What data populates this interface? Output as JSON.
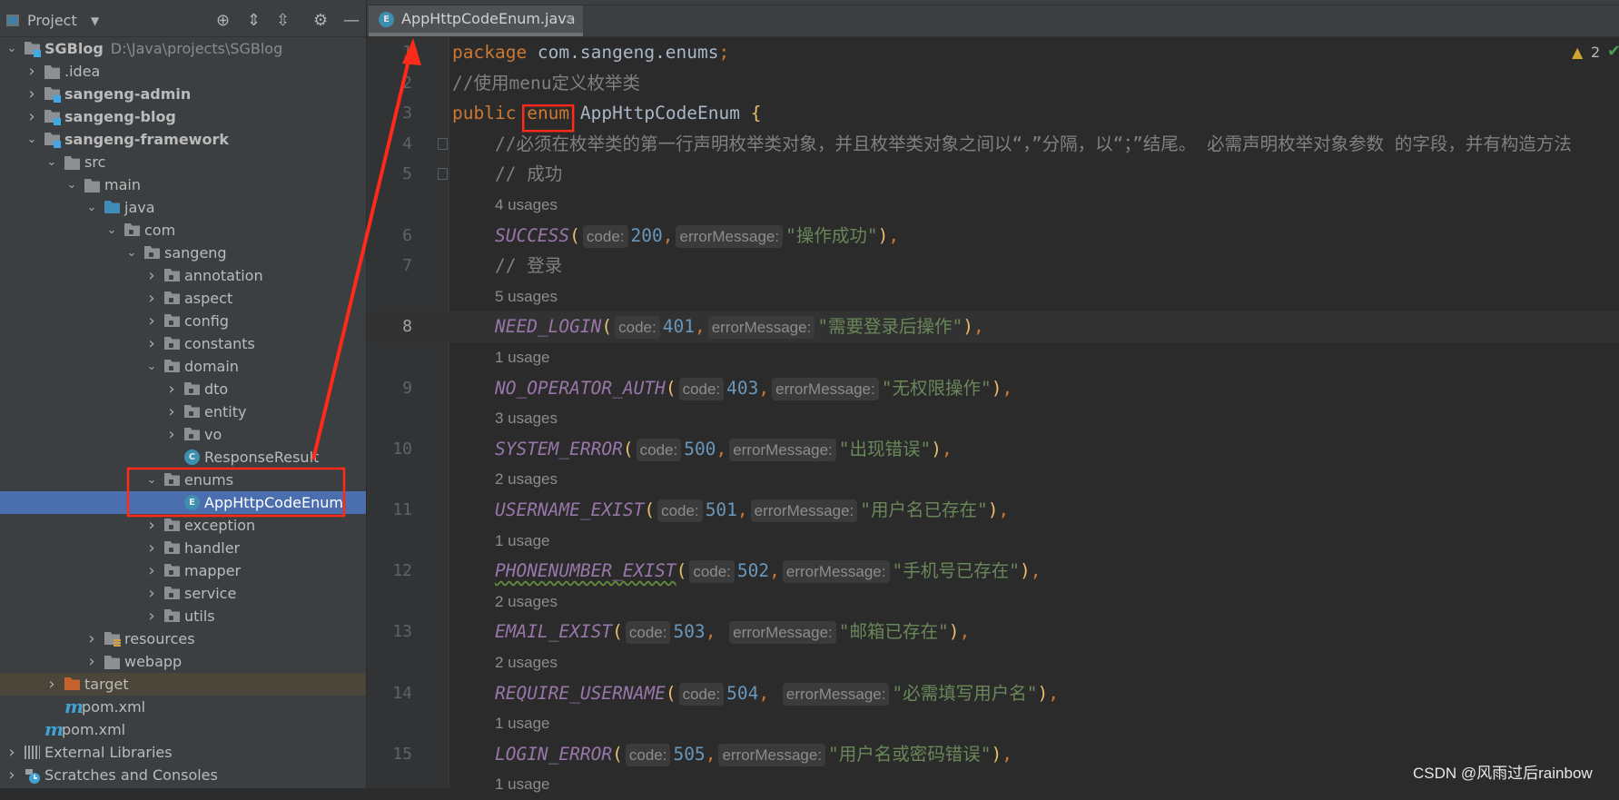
{
  "project_panel": {
    "title": "Project",
    "header_icons": [
      "locate-icon",
      "expand-all-icon",
      "collapse-all-icon",
      "gear-icon",
      "minimize-icon"
    ],
    "tree": [
      {
        "label": "SGBlog",
        "path": "D:\\Java\\projects\\SGBlog",
        "level": 0,
        "arrow": "open",
        "icon": "module",
        "bold": true
      },
      {
        "label": ".idea",
        "level": 1,
        "arrow": "closed",
        "icon": "folder"
      },
      {
        "label": "sangeng-admin",
        "level": 1,
        "arrow": "closed",
        "icon": "module",
        "bold": true
      },
      {
        "label": "sangeng-blog",
        "level": 1,
        "arrow": "closed",
        "icon": "module",
        "bold": true
      },
      {
        "label": "sangeng-framework",
        "level": 1,
        "arrow": "open",
        "icon": "module",
        "bold": true
      },
      {
        "label": "src",
        "level": 2,
        "arrow": "open",
        "icon": "folder"
      },
      {
        "label": "main",
        "level": 3,
        "arrow": "open",
        "icon": "folder"
      },
      {
        "label": "java",
        "level": 4,
        "arrow": "open",
        "icon": "java"
      },
      {
        "label": "com",
        "level": 5,
        "arrow": "open",
        "icon": "package"
      },
      {
        "label": "sangeng",
        "level": 6,
        "arrow": "open",
        "icon": "package"
      },
      {
        "label": "annotation",
        "level": 7,
        "arrow": "closed",
        "icon": "package"
      },
      {
        "label": "aspect",
        "level": 7,
        "arrow": "closed",
        "icon": "package"
      },
      {
        "label": "config",
        "level": 7,
        "arrow": "closed",
        "icon": "package"
      },
      {
        "label": "constants",
        "level": 7,
        "arrow": "closed",
        "icon": "package"
      },
      {
        "label": "domain",
        "level": 7,
        "arrow": "open",
        "icon": "package"
      },
      {
        "label": "dto",
        "level": 8,
        "arrow": "closed",
        "icon": "package"
      },
      {
        "label": "entity",
        "level": 8,
        "arrow": "closed",
        "icon": "package"
      },
      {
        "label": "vo",
        "level": 8,
        "arrow": "closed",
        "icon": "package"
      },
      {
        "label": "ResponseResult",
        "level": 8,
        "arrow": "none",
        "icon": "class"
      },
      {
        "label": "enums",
        "level": 7,
        "arrow": "open",
        "icon": "package"
      },
      {
        "label": "AppHttpCodeEnum",
        "level": 8,
        "arrow": "none",
        "icon": "enum",
        "selected": true
      },
      {
        "label": "exception",
        "level": 7,
        "arrow": "closed",
        "icon": "package"
      },
      {
        "label": "handler",
        "level": 7,
        "arrow": "closed",
        "icon": "package"
      },
      {
        "label": "mapper",
        "level": 7,
        "arrow": "closed",
        "icon": "package"
      },
      {
        "label": "service",
        "level": 7,
        "arrow": "closed",
        "icon": "package"
      },
      {
        "label": "utils",
        "level": 7,
        "arrow": "closed",
        "icon": "package"
      },
      {
        "label": "resources",
        "level": 4,
        "arrow": "closed",
        "icon": "resources"
      },
      {
        "label": "webapp",
        "level": 4,
        "arrow": "closed",
        "icon": "folder"
      },
      {
        "label": "target",
        "level": 2,
        "arrow": "closed",
        "icon": "target",
        "excluded": true
      },
      {
        "label": "pom.xml",
        "level": 2,
        "arrow": "none",
        "icon": "maven"
      },
      {
        "label": "pom.xml",
        "level": 1,
        "arrow": "none",
        "icon": "maven"
      },
      {
        "label": "External Libraries",
        "level": 0,
        "arrow": "closed",
        "icon": "libraries"
      },
      {
        "label": "Scratches and Consoles",
        "level": 0,
        "arrow": "closed",
        "icon": "scratches"
      }
    ]
  },
  "editor": {
    "tab": {
      "label": "AppHttpCodeEnum.java",
      "icon_letter": "E",
      "close": "✕"
    },
    "inspections": {
      "warning_icon": "▲",
      "warning_count": "2",
      "ok_icon": "✔"
    },
    "current_line": "8",
    "rows": [
      {
        "ln": "1",
        "tokens": [
          [
            "kw",
            "package"
          ],
          [
            "plain",
            " com.sangeng.enums"
          ],
          [
            "kw",
            ";"
          ]
        ]
      },
      {
        "ln": "2",
        "tokens": [
          [
            "cm",
            "//使用menu定义枚举类"
          ]
        ]
      },
      {
        "ln": "3",
        "tokens": [
          [
            "kw",
            "public"
          ],
          [
            "plain",
            " "
          ],
          [
            "kw enumbox",
            "enum"
          ],
          [
            "plain",
            " AppHttpCodeEnum "
          ],
          [
            "paren",
            "{"
          ]
        ]
      },
      {
        "ln": "4",
        "fold": true,
        "tokens": [
          [
            "plain",
            "    "
          ],
          [
            "cm",
            "//必须在枚举类的第一行声明枚举类对象，并且枚举类对象之间以“，”分隔，以“；”结尾。 必需声明枚举对象参数 的字段，并有构造方法"
          ]
        ]
      },
      {
        "ln": "5",
        "fold": true,
        "tokens": [
          [
            "plain",
            "    "
          ],
          [
            "cm",
            "// 成功"
          ]
        ]
      },
      {
        "usage": "4 usages"
      },
      {
        "ln": "6",
        "tokens": [
          [
            "plain",
            "    "
          ],
          [
            "const",
            "SUCCESS"
          ],
          [
            "paren",
            "("
          ],
          [
            "hint",
            "code:"
          ],
          [
            "num",
            "200"
          ],
          [
            "punc",
            ","
          ],
          [
            "hint",
            "errorMessage:"
          ],
          [
            "str",
            "\"操作成功\""
          ],
          [
            "paren",
            ")"
          ],
          [
            "punc",
            ","
          ]
        ]
      },
      {
        "ln": "7",
        "tokens": [
          [
            "plain",
            "    "
          ],
          [
            "cm",
            "// 登录"
          ]
        ]
      },
      {
        "usage": "5 usages"
      },
      {
        "ln": "8",
        "tokens": [
          [
            "plain",
            "    "
          ],
          [
            "const",
            "NEED_LOGIN"
          ],
          [
            "paren",
            "("
          ],
          [
            "hint",
            "code:"
          ],
          [
            "num",
            "401"
          ],
          [
            "punc",
            ","
          ],
          [
            "hint",
            "errorMessage:"
          ],
          [
            "str",
            "\"需要登录后操作\""
          ],
          [
            "paren",
            ")"
          ],
          [
            "punc",
            ","
          ]
        ]
      },
      {
        "usage": "1 usage"
      },
      {
        "ln": "9",
        "tokens": [
          [
            "plain",
            "    "
          ],
          [
            "const",
            "NO_OPERATOR_AUTH"
          ],
          [
            "paren",
            "("
          ],
          [
            "hint",
            "code:"
          ],
          [
            "num",
            "403"
          ],
          [
            "punc",
            ","
          ],
          [
            "hint",
            "errorMessage:"
          ],
          [
            "str",
            "\"无权限操作\""
          ],
          [
            "paren",
            ")"
          ],
          [
            "punc",
            ","
          ]
        ]
      },
      {
        "usage": "3 usages"
      },
      {
        "ln": "10",
        "tokens": [
          [
            "plain",
            "    "
          ],
          [
            "const",
            "SYSTEM_ERROR"
          ],
          [
            "paren",
            "("
          ],
          [
            "hint",
            "code:"
          ],
          [
            "num",
            "500"
          ],
          [
            "punc",
            ","
          ],
          [
            "hint",
            "errorMessage:"
          ],
          [
            "str",
            "\"出现错误\""
          ],
          [
            "paren",
            ")"
          ],
          [
            "punc",
            ","
          ]
        ]
      },
      {
        "usage": "2 usages"
      },
      {
        "ln": "11",
        "tokens": [
          [
            "plain",
            "    "
          ],
          [
            "const",
            "USERNAME_EXIST"
          ],
          [
            "paren",
            "("
          ],
          [
            "hint",
            "code:"
          ],
          [
            "num",
            "501"
          ],
          [
            "punc",
            ","
          ],
          [
            "hint",
            "errorMessage:"
          ],
          [
            "str",
            "\"用户名已存在\""
          ],
          [
            "paren",
            ")"
          ],
          [
            "punc",
            ","
          ]
        ]
      },
      {
        "usage": "1 usage"
      },
      {
        "ln": "12",
        "tokens": [
          [
            "plain",
            "    "
          ],
          [
            "const squiggle",
            "PHONENUMBER_EXIST"
          ],
          [
            "paren",
            "("
          ],
          [
            "hint",
            "code:"
          ],
          [
            "num",
            "502"
          ],
          [
            "punc",
            ","
          ],
          [
            "hint",
            "errorMessage:"
          ],
          [
            "str",
            "\"手机号已存在\""
          ],
          [
            "paren",
            ")"
          ],
          [
            "punc",
            ","
          ]
        ]
      },
      {
        "usage": "2 usages"
      },
      {
        "ln": "13",
        "tokens": [
          [
            "plain",
            "    "
          ],
          [
            "const",
            "EMAIL_EXIST"
          ],
          [
            "paren",
            "("
          ],
          [
            "hint",
            "code:"
          ],
          [
            "num",
            "503"
          ],
          [
            "punc",
            ", "
          ],
          [
            "hint",
            "errorMessage:"
          ],
          [
            "str",
            "\"邮箱已存在\""
          ],
          [
            "paren",
            ")"
          ],
          [
            "punc",
            ","
          ]
        ]
      },
      {
        "usage": "2 usages"
      },
      {
        "ln": "14",
        "tokens": [
          [
            "plain",
            "    "
          ],
          [
            "const",
            "REQUIRE_USERNAME"
          ],
          [
            "paren",
            "("
          ],
          [
            "hint",
            "code:"
          ],
          [
            "num",
            "504"
          ],
          [
            "punc",
            ", "
          ],
          [
            "hint",
            "errorMessage:"
          ],
          [
            "str",
            "\"必需填写用户名\""
          ],
          [
            "paren",
            ")"
          ],
          [
            "punc",
            ","
          ]
        ]
      },
      {
        "usage": "1 usage"
      },
      {
        "ln": "15",
        "tokens": [
          [
            "plain",
            "    "
          ],
          [
            "const",
            "LOGIN_ERROR"
          ],
          [
            "paren",
            "("
          ],
          [
            "hint",
            "code:"
          ],
          [
            "num",
            "505"
          ],
          [
            "punc",
            ","
          ],
          [
            "hint",
            "errorMessage:"
          ],
          [
            "str",
            "\"用户名或密码错误\""
          ],
          [
            "paren",
            ")"
          ],
          [
            "punc",
            ","
          ]
        ]
      },
      {
        "usage": "1 usage"
      }
    ]
  },
  "annotation_color": "#ff2a1a",
  "watermark": "CSDN @风雨过后rainbow"
}
